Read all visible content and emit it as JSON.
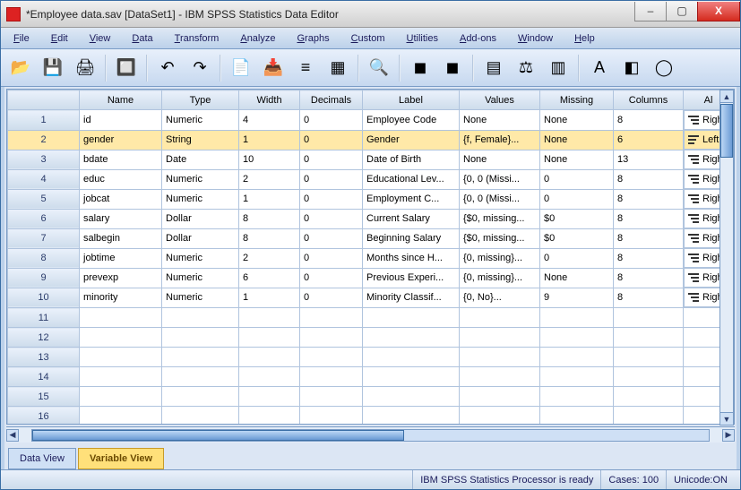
{
  "titlebar": {
    "title": "*Employee data.sav [DataSet1] - IBM SPSS Statistics Data Editor",
    "min": "–",
    "max": "▢",
    "close": "X"
  },
  "menu": {
    "items": [
      "File",
      "Edit",
      "View",
      "Data",
      "Transform",
      "Analyze",
      "Graphs",
      "Custom",
      "Utilities",
      "Add-ons",
      "Window",
      "Help"
    ]
  },
  "toolbar": {
    "icons": [
      "open",
      "save",
      "print",
      "recall",
      "undo",
      "redo",
      "goto-case",
      "goto-var",
      "variables",
      "run",
      "find",
      "insert-case",
      "insert-var",
      "split",
      "weight",
      "select",
      "value-labels",
      "use-sets",
      "customize"
    ]
  },
  "columns": [
    "",
    "Name",
    "Type",
    "Width",
    "Decimals",
    "Label",
    "Values",
    "Missing",
    "Columns",
    "Al"
  ],
  "rows": [
    {
      "n": "1",
      "name": "id",
      "type": "Numeric",
      "width": "4",
      "dec": "0",
      "label": "Employee Code",
      "values": "None",
      "missing": "None",
      "cols": "8",
      "align": "Righ",
      "alignClass": "right"
    },
    {
      "n": "2",
      "name": "gender",
      "type": "String",
      "width": "1",
      "dec": "0",
      "label": "Gender",
      "values": "{f, Female}...",
      "missing": "None",
      "cols": "6",
      "align": "Left",
      "alignClass": "left",
      "selected": true
    },
    {
      "n": "3",
      "name": "bdate",
      "type": "Date",
      "width": "10",
      "dec": "0",
      "label": "Date of Birth",
      "values": "None",
      "missing": "None",
      "cols": "13",
      "align": "Righ",
      "alignClass": "right"
    },
    {
      "n": "4",
      "name": "educ",
      "type": "Numeric",
      "width": "2",
      "dec": "0",
      "label": "Educational Lev...",
      "values": "{0, 0 (Missi...",
      "missing": "0",
      "cols": "8",
      "align": "Righ",
      "alignClass": "right"
    },
    {
      "n": "5",
      "name": "jobcat",
      "type": "Numeric",
      "width": "1",
      "dec": "0",
      "label": "Employment C...",
      "values": "{0, 0 (Missi...",
      "missing": "0",
      "cols": "8",
      "align": "Righ",
      "alignClass": "right"
    },
    {
      "n": "6",
      "name": "salary",
      "type": "Dollar",
      "width": "8",
      "dec": "0",
      "label": "Current Salary",
      "values": "{$0, missing...",
      "missing": "$0",
      "cols": "8",
      "align": "Righ",
      "alignClass": "right"
    },
    {
      "n": "7",
      "name": "salbegin",
      "type": "Dollar",
      "width": "8",
      "dec": "0",
      "label": "Beginning Salary",
      "values": "{$0, missing...",
      "missing": "$0",
      "cols": "8",
      "align": "Righ",
      "alignClass": "right"
    },
    {
      "n": "8",
      "name": "jobtime",
      "type": "Numeric",
      "width": "2",
      "dec": "0",
      "label": "Months since H...",
      "values": "{0, missing}...",
      "missing": "0",
      "cols": "8",
      "align": "Righ",
      "alignClass": "right"
    },
    {
      "n": "9",
      "name": "prevexp",
      "type": "Numeric",
      "width": "6",
      "dec": "0",
      "label": "Previous Experi...",
      "values": "{0, missing}...",
      "missing": "None",
      "cols": "8",
      "align": "Righ",
      "alignClass": "right"
    },
    {
      "n": "10",
      "name": "minority",
      "type": "Numeric",
      "width": "1",
      "dec": "0",
      "label": "Minority Classif...",
      "values": "{0, No}...",
      "missing": "9",
      "cols": "8",
      "align": "Righ",
      "alignClass": "right"
    }
  ],
  "emptyRows": [
    "11",
    "12",
    "13",
    "14",
    "15",
    "16"
  ],
  "tabs": {
    "data": "Data View",
    "variable": "Variable View"
  },
  "status": {
    "processor": "IBM SPSS Statistics Processor is ready",
    "cases": "Cases: 100",
    "unicode": "Unicode:ON"
  }
}
